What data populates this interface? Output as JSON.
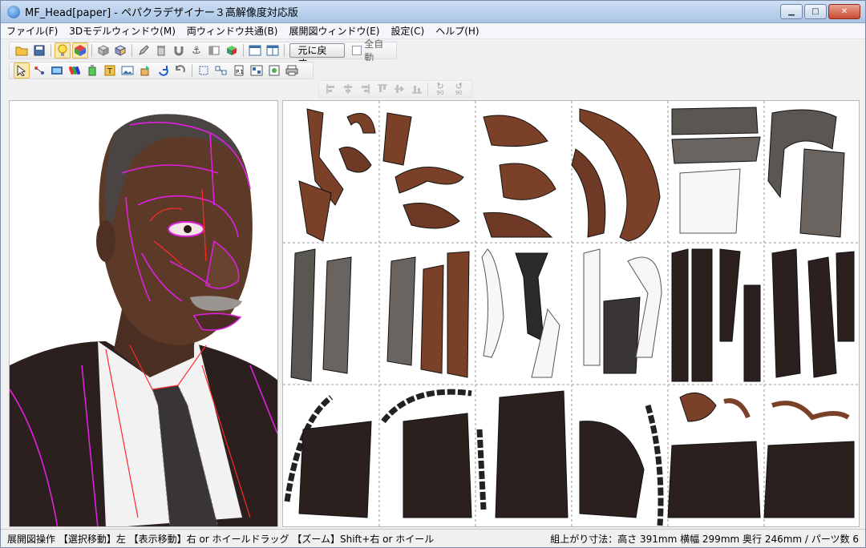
{
  "window": {
    "title": "MF_Head[paper] - ペパクラデザイナー３高解像度対応版",
    "controls": {
      "minimize": "▁",
      "maximize": "□",
      "close": "✕"
    }
  },
  "menu": [
    {
      "label": "ファイル(F)"
    },
    {
      "label": "3Dモデルウィンドウ(M)"
    },
    {
      "label": "両ウィンドウ共通(B)"
    },
    {
      "label": "展開図ウィンドウ(E)"
    },
    {
      "label": "設定(C)"
    },
    {
      "label": "ヘルプ(H)"
    }
  ],
  "toolbar1": {
    "reset_label": "元に戻す",
    "auto_label": "全自動"
  },
  "toolbar3": {
    "rotate_a": "90",
    "rotate_b": "90"
  },
  "status": {
    "left": "展開図操作 【選択移動】左 【表示移動】右 or ホイールドラッグ 【ズーム】Shift+右 or ホイール",
    "right": "組上がり寸法：高さ 391mm 横幅 299mm 奥行 246mm / パーツ数 6"
  },
  "colors": {
    "accent": "#3a6ea5",
    "edge_highlight": "#e020e0",
    "cut_line": "#ff2a2a",
    "skin": "#5a3a2a",
    "suit": "#2a1f1d"
  }
}
